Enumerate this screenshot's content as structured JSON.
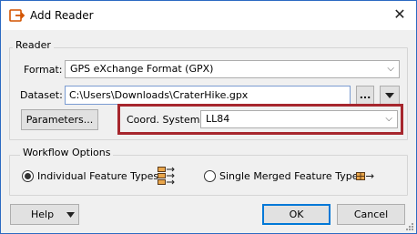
{
  "window": {
    "title": "Add Reader"
  },
  "reader": {
    "group_label": "Reader",
    "format_label": "Format:",
    "format_value": "GPS eXchange Format (GPX)",
    "dataset_label": "Dataset:",
    "dataset_value": "C:\\Users\\Downloads\\CraterHike.gpx",
    "browse_label": "...",
    "parameters_label": "Parameters...",
    "coord_label": "Coord. System:",
    "coord_value": "LL84"
  },
  "workflow": {
    "group_label": "Workflow Options",
    "option_individual": "Individual Feature Types",
    "option_merged": "Single Merged Feature Type",
    "selected": "Individual Feature Types"
  },
  "footer": {
    "help_label": "Help",
    "ok_label": "OK",
    "cancel_label": "Cancel"
  },
  "colors": {
    "highlight": "#a6262d",
    "accent": "#0078d7",
    "icon_orange": "#d35400"
  }
}
